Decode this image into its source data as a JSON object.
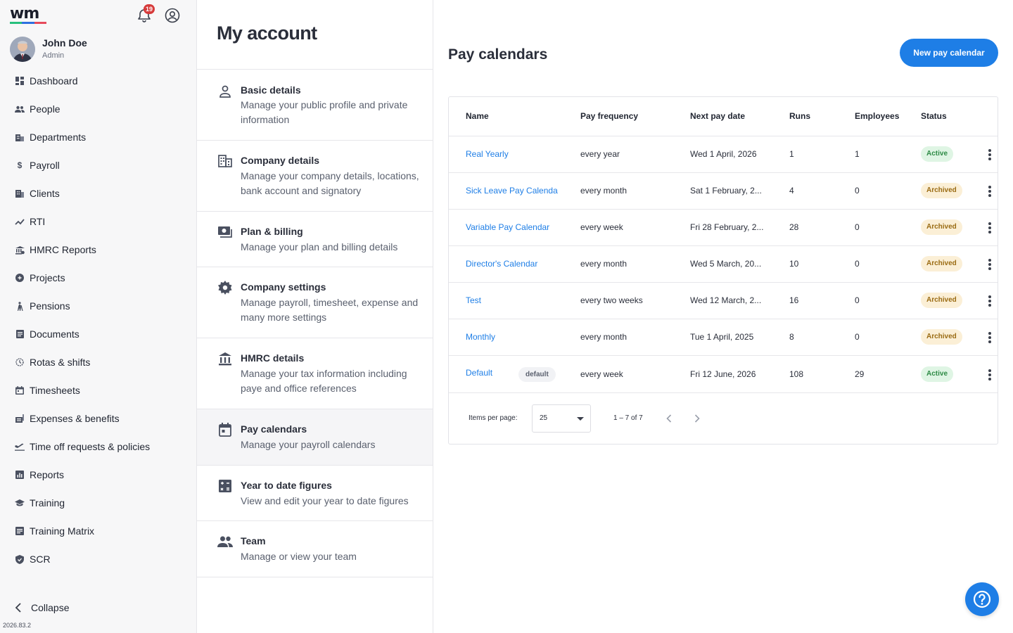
{
  "brand": {
    "logo_text": "wm",
    "colors": {
      "green": "#27c07d",
      "blue": "#2d6fe0",
      "red": "#e64a5b",
      "accent": "#1e7ee6"
    }
  },
  "header": {
    "notification_count": "19"
  },
  "user": {
    "name": "John Doe",
    "role": "Admin"
  },
  "sidebar": {
    "items": [
      {
        "label": "Dashboard",
        "icon": "dashboard-icon"
      },
      {
        "label": "People",
        "icon": "people-icon"
      },
      {
        "label": "Departments",
        "icon": "building-icon"
      },
      {
        "label": "Payroll",
        "icon": "dollar-icon"
      },
      {
        "label": "Clients",
        "icon": "clients-icon"
      },
      {
        "label": "RTI",
        "icon": "trend-icon"
      },
      {
        "label": "HMRC Reports",
        "icon": "bank-icon"
      },
      {
        "label": "Projects",
        "icon": "projects-icon"
      },
      {
        "label": "Pensions",
        "icon": "pensions-icon"
      },
      {
        "label": "Documents",
        "icon": "document-icon"
      },
      {
        "label": "Rotas & shifts",
        "icon": "clock-icon"
      },
      {
        "label": "Timesheets",
        "icon": "calendar-icon"
      },
      {
        "label": "Expenses & benefits",
        "icon": "receipt-icon"
      },
      {
        "label": "Time off requests & policies",
        "icon": "plane-icon"
      },
      {
        "label": "Reports",
        "icon": "report-icon"
      },
      {
        "label": "Training",
        "icon": "graduation-icon"
      },
      {
        "label": "Training Matrix",
        "icon": "matrix-icon"
      },
      {
        "label": "SCR",
        "icon": "shield-icon"
      }
    ],
    "collapse_label": "Collapse",
    "version": "2026.83.2"
  },
  "settings": {
    "title": "My account",
    "items": [
      {
        "title": "Basic details",
        "desc": "Manage your public profile and private information"
      },
      {
        "title": "Company details",
        "desc": "Manage your company details, locations, bank account and signatory"
      },
      {
        "title": "Plan & billing",
        "desc": "Manage your plan and billing details"
      },
      {
        "title": "Company settings",
        "desc": "Manage payroll, timesheet, expense and many more settings"
      },
      {
        "title": "HMRC details",
        "desc": "Manage your tax information including paye and office references"
      },
      {
        "title": "Pay calendars",
        "desc": "Manage your payroll calendars"
      },
      {
        "title": "Year to date figures",
        "desc": "View and edit your year to date figures"
      },
      {
        "title": "Team",
        "desc": "Manage or view your team"
      }
    ]
  },
  "main": {
    "title": "Pay calendars",
    "new_button": "New pay calendar",
    "table": {
      "headers": {
        "name": "Name",
        "frequency": "Pay frequency",
        "next": "Next pay date",
        "runs": "Runs",
        "employees": "Employees",
        "status": "Status"
      },
      "rows": [
        {
          "name": "Real Yearly",
          "frequency": "every year",
          "next": "Wed 1 April, 2026",
          "runs": "1",
          "employees": "1",
          "status": "Active"
        },
        {
          "name": "Sick Leave Pay Calenda",
          "frequency": "every month",
          "next": "Sat 1 February, 2...",
          "runs": "4",
          "employees": "0",
          "status": "Archived"
        },
        {
          "name": "Variable Pay Calendar",
          "frequency": "every week",
          "next": "Fri 28 February, 2...",
          "runs": "28",
          "employees": "0",
          "status": "Archived"
        },
        {
          "name": "Director's Calendar",
          "frequency": "every month",
          "next": "Wed 5 March, 20...",
          "runs": "10",
          "employees": "0",
          "status": "Archived"
        },
        {
          "name": "Test",
          "frequency": "every two weeks",
          "next": "Wed 12 March, 2...",
          "runs": "16",
          "employees": "0",
          "status": "Archived"
        },
        {
          "name": "Monthly",
          "frequency": "every month",
          "next": "Tue 1 April, 2025",
          "runs": "8",
          "employees": "0",
          "status": "Archived"
        },
        {
          "name": "Default",
          "tag": "default",
          "frequency": "every week",
          "next": "Fri 12 June, 2026",
          "runs": "108",
          "employees": "29",
          "status": "Active"
        }
      ]
    },
    "pagination": {
      "items_per_page_label": "Items per page:",
      "items_per_page": "25",
      "range": "1 – 7 of 7"
    }
  }
}
